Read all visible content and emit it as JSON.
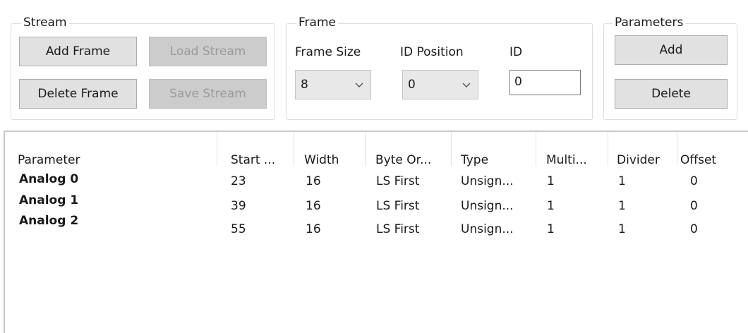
{
  "stream": {
    "title": "Stream",
    "add_frame": "Add Frame",
    "load_stream": "Load Stream",
    "delete_frame": "Delete Frame",
    "save_stream": "Save Stream"
  },
  "frame": {
    "title": "Frame",
    "frame_size_label": "Frame Size",
    "id_position_label": "ID Position",
    "id_label": "ID",
    "frame_size_value": "8",
    "id_position_value": "0",
    "id_value": "0",
    "dropdown_icon": "chevron-down-icon"
  },
  "parameters": {
    "title": "Parameters",
    "add": "Add",
    "delete": "Delete"
  },
  "table": {
    "columns": [
      "Parameter",
      "Start ...",
      "Width",
      "Byte Or...",
      "Type",
      "Multi...",
      "Divider",
      "Offset"
    ],
    "rows": [
      {
        "name": "Analog 0",
        "cells": [
          "23",
          "16",
          "LS First",
          "Unsign...",
          "1",
          "1",
          "0"
        ]
      },
      {
        "name": "Analog 1",
        "cells": [
          "39",
          "16",
          "LS First",
          "Unsign...",
          "1",
          "1",
          "0"
        ]
      },
      {
        "name": "Analog 2",
        "cells": [
          "55",
          "16",
          "LS First",
          "Unsign...",
          "1",
          "1",
          "0"
        ]
      }
    ]
  },
  "colors": {
    "button_bg": "#e1e1e1",
    "button_disabled_bg": "#cccccc",
    "disabled_text": "#9a9a9a",
    "groupbox_border": "#dcdcdc"
  }
}
